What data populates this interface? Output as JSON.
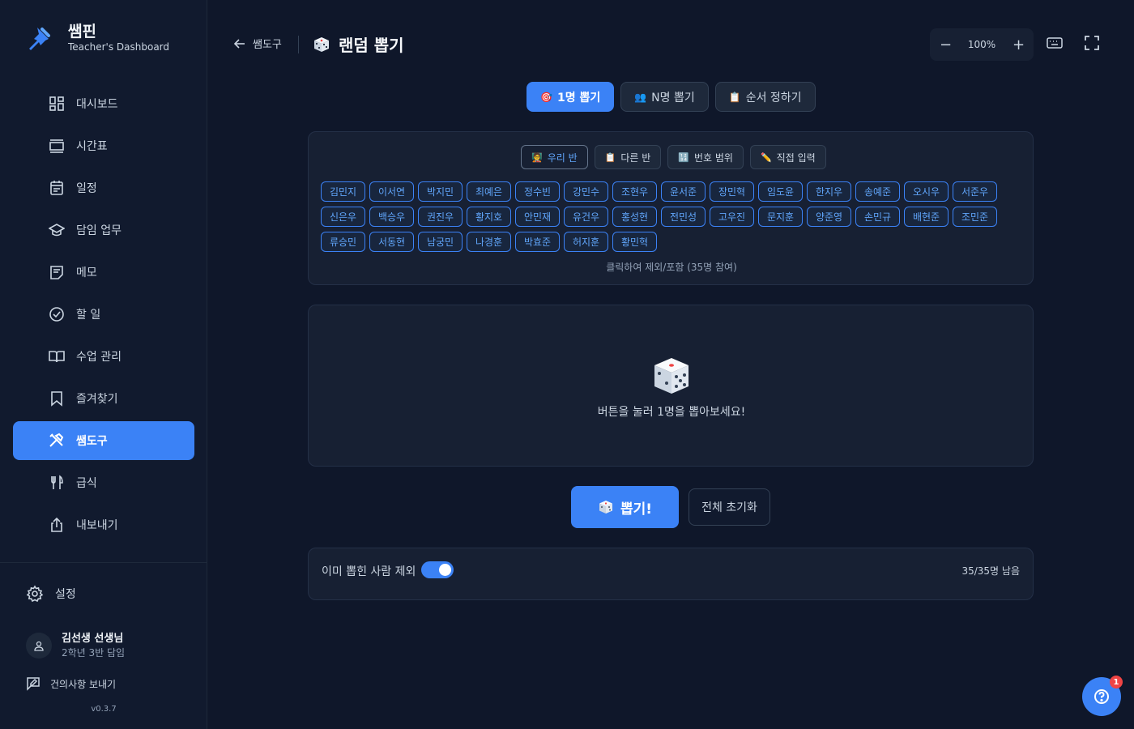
{
  "brand": {
    "title": "쌤핀",
    "subtitle": "Teacher's Dashboard"
  },
  "sidebar": {
    "items": [
      {
        "label": "대시보드",
        "icon": "dashboard-icon"
      },
      {
        "label": "시간표",
        "icon": "timetable-icon"
      },
      {
        "label": "일정",
        "icon": "calendar-icon"
      },
      {
        "label": "담임 업무",
        "icon": "graduation-cap-icon"
      },
      {
        "label": "메모",
        "icon": "memo-icon"
      },
      {
        "label": "할 일",
        "icon": "check-circle-icon"
      },
      {
        "label": "수업 관리",
        "icon": "book-open-icon"
      },
      {
        "label": "즐겨찾기",
        "icon": "bookmark-icon"
      },
      {
        "label": "쌤도구",
        "icon": "tools-icon",
        "active": true
      },
      {
        "label": "급식",
        "icon": "utensils-icon"
      },
      {
        "label": "내보내기",
        "icon": "share-icon"
      }
    ],
    "settings_label": "설정",
    "user": {
      "name": "김선생 선생님",
      "role": "2학년 3반 담임"
    },
    "feedback_label": "건의사항 보내기",
    "version": "v0.3.7"
  },
  "header": {
    "back_label": "쌤도구",
    "title": "랜덤 뽑기",
    "zoom": {
      "minus": "−",
      "value": "100%",
      "plus": "+"
    }
  },
  "mode_tabs": [
    {
      "label": "1명 뽑기",
      "icon": "🎯",
      "active": true
    },
    {
      "label": "N명 뽑기",
      "icon": "👥",
      "active": false
    },
    {
      "label": "순서 정하기",
      "icon": "📋",
      "active": false
    }
  ],
  "source_tabs": [
    {
      "label": "우리 반",
      "icon": "🧑‍🏫",
      "active": true
    },
    {
      "label": "다른 반",
      "icon": "📋",
      "active": false
    },
    {
      "label": "번호 범위",
      "icon": "🔢",
      "active": false
    },
    {
      "label": "직접 입력",
      "icon": "✏️",
      "active": false
    }
  ],
  "students": [
    "김민지",
    "이서연",
    "박지민",
    "최예은",
    "정수빈",
    "강민수",
    "조현우",
    "윤서준",
    "장민혁",
    "임도윤",
    "한지우",
    "송예준",
    "오시우",
    "서준우",
    "신은우",
    "백승우",
    "권진우",
    "황지호",
    "안민재",
    "유건우",
    "홍성현",
    "전민성",
    "고우진",
    "문지훈",
    "양준영",
    "손민규",
    "배현준",
    "조민준",
    "류승민",
    "서동현",
    "남궁민",
    "나경훈",
    "박효준",
    "허지훈",
    "황민혁"
  ],
  "chip_note": "클릭하여 제외/포함 (35명 참여)",
  "result": {
    "message": "버튼을 눌러 1명을 뽑아보세요!"
  },
  "actions": {
    "draw_label": "뽑기!",
    "reset_label": "전체 초기화"
  },
  "options": {
    "exclude_label": "이미 뽑힌 사람 제외",
    "exclude_on": true,
    "remaining": "35/35명 남음"
  },
  "help": {
    "badge": "1"
  },
  "colors": {
    "accent": "#3b82f6",
    "background": "#0f172a",
    "sidebar": "#111a2e",
    "badge": "#ef4444"
  }
}
